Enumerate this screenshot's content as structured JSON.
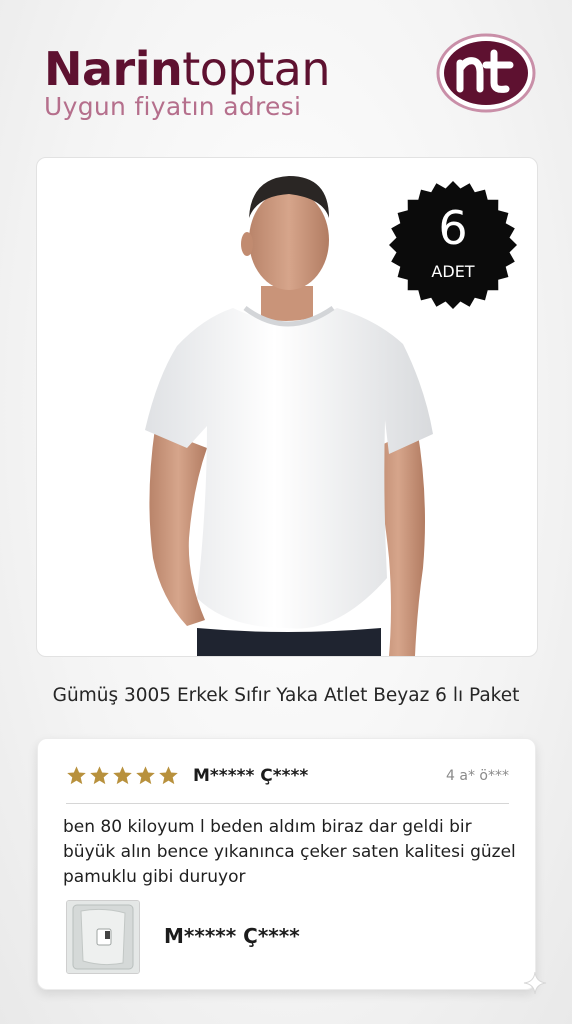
{
  "brand": {
    "name_bold": "Narin",
    "name_regular": "toptan",
    "tagline": "Uygun fiyatın adresi",
    "logo_mark_text": "nt",
    "logo_icon": "brand-logo-icon"
  },
  "product": {
    "badge_count": "6",
    "badge_unit": "ADET",
    "title": "Gümüş 3005 Erkek Sıfır Yaka Atlet Beyaz 6 lı Paket",
    "image_icon": "man-in-white-tshirt"
  },
  "review": {
    "rating": 5,
    "rating_max": 5,
    "reviewer": "M***** Ç****",
    "date": "4 a* ö***",
    "text": "ben 80 kiloyum l beden aldım biraz dar geldi bir büyük alın bence yıkanınca çeker saten kalitesi güzel pamuklu gibi duruyor",
    "photo_icon": "review-photo-thumbnail"
  },
  "colors": {
    "brand": "#5e1130",
    "tagline": "#b56f8c",
    "star": "#b8913d",
    "badge": "#0b0b0b"
  }
}
